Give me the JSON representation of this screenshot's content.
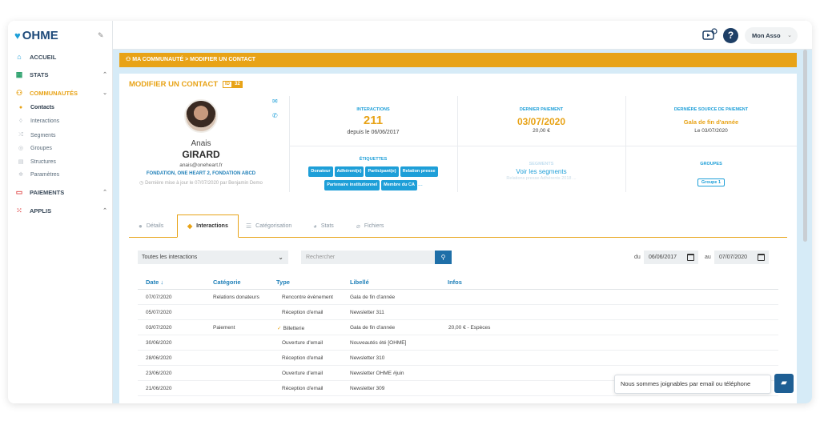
{
  "brand": {
    "logo_text": "OHME"
  },
  "sidebar": {
    "items": [
      {
        "label": "ACCUEIL"
      },
      {
        "label": "STATS"
      },
      {
        "label": "COMMUNAUTÉS"
      },
      {
        "label": "PAIEMENTS"
      },
      {
        "label": "APPLIS"
      }
    ],
    "sub_items": [
      {
        "label": "Contacts"
      },
      {
        "label": "Interactions"
      },
      {
        "label": "Segments"
      },
      {
        "label": "Groupes"
      },
      {
        "label": "Structures"
      },
      {
        "label": "Paramètres"
      }
    ]
  },
  "topbar": {
    "help": "?",
    "account": "Mon Asso"
  },
  "breadcrumb": {
    "text": "MA COMMUNAUTÉ > MODIFIER UN CONTACT"
  },
  "contact": {
    "page_title": "MODIFIER UN CONTACT",
    "id_label": "ID",
    "id_value": "32",
    "first_name": "Anais",
    "last_name": "GIRARD",
    "email": "anais@oneheart.fr",
    "orgs": "FONDATION, ONE HEART 2, FONDATION ABCD",
    "updated": "Dernière mise à jour le 07/07/2020 par Benjamin Demo"
  },
  "stats": {
    "interactions": {
      "label": "INTERACTIONS",
      "value": "211",
      "sub": "depuis le 06/06/2017"
    },
    "last_payment": {
      "label": "DERNIER PAIEMENT",
      "value": "03/07/2020",
      "sub": "20,00 €"
    },
    "last_source": {
      "label": "DERNIÈRE SOURCE DE PAIEMENT",
      "value": "Gala de fin d'année",
      "sub": "Le 03/07/2020"
    },
    "labels": {
      "label": "ÉTIQUETTES",
      "tags": [
        "Donateur",
        "Adhérent(e)",
        "Participant(e)",
        "Relation presse",
        "Partenaire institutionnel",
        "Membre du CA"
      ],
      "more": "..."
    },
    "segments": {
      "label": "SEGMENTS",
      "link": "Voir les segments",
      "faded": "Relations presse    Adhérents 2018    ..."
    },
    "groups": {
      "label": "GROUPES",
      "group": "Groupe 1"
    }
  },
  "tabs": [
    {
      "label": "Détails"
    },
    {
      "label": "Interactions"
    },
    {
      "label": "Catégorisation"
    },
    {
      "label": "Stats"
    },
    {
      "label": "Fichiers"
    }
  ],
  "filters": {
    "type_select": "Toutes les interactions",
    "search_placeholder": "Rechercher",
    "date_from_label": "du",
    "date_from": "06/06/2017",
    "date_to_label": "au",
    "date_to": "07/07/2020"
  },
  "table": {
    "headers": [
      "Date",
      "Catégorie",
      "Type",
      "Libellé",
      "Infos"
    ],
    "rows": [
      [
        "07/07/2020",
        "Relations donateurs",
        "Rencontre évènement",
        "Gala de fin d'année",
        ""
      ],
      [
        "05/07/2020",
        "",
        "Réception d'email",
        "Newsletter 311",
        ""
      ],
      [
        "03/07/2020",
        "Paiement",
        "Billetterie",
        "Gala de fin d'année",
        "20,00 € - Espèces"
      ],
      [
        "30/06/2020",
        "",
        "Ouverture d'email",
        "Nouveautés été [OHME]",
        ""
      ],
      [
        "28/06/2020",
        "",
        "Réception d'email",
        "Newsletter 310",
        ""
      ],
      [
        "23/06/2020",
        "",
        "Ouverture d'email",
        "Newsletter OHME #juin",
        ""
      ],
      [
        "21/06/2020",
        "",
        "Réception d'email",
        "Newsletter 309",
        ""
      ]
    ]
  },
  "chat": {
    "text": "Nous sommes joignables par email ou téléphone"
  },
  "colors": {
    "accent": "#e8a317",
    "primary": "#1e9fd8",
    "dark": "#1e3f66"
  }
}
